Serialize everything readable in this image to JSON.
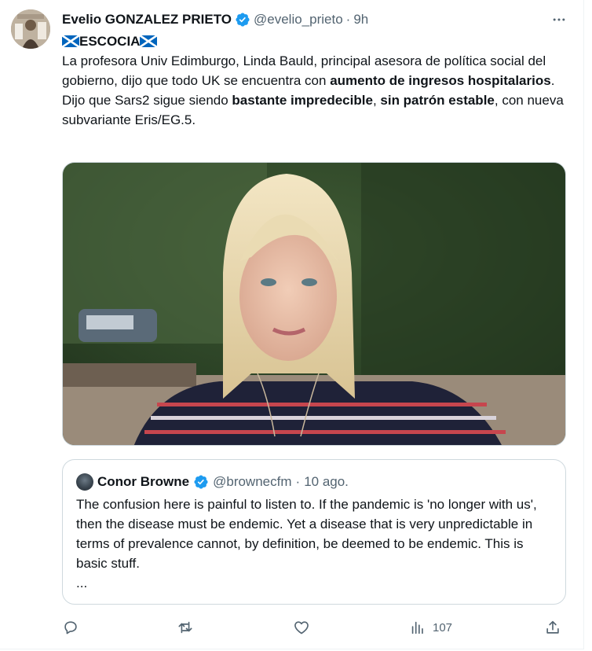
{
  "tweet": {
    "author_name": "Evelio GONZALEZ PRIETO",
    "author_handle": "@evelio_prieto",
    "separator": "·",
    "time": "9h",
    "title_text": "ESCOCIA",
    "line1_prefix": "La profesora Univ Edimburgo, Linda Bauld, principal asesora de política social del gobierno, dijo que todo UK se encuentra con ",
    "line1_bold": "aumento de ingresos hospitalarios",
    "line1_suffix": ".",
    "line2_prefix": "Dijo que Sars2 sigue siendo ",
    "line2_bold1": "bastante impredecible",
    "line2_mid": ", ",
    "line2_bold2": "sin patrón estable",
    "line2_suffix": ", con nueva subvariante Eris/EG.5."
  },
  "quoted_tweet": {
    "author_name": "Conor Browne",
    "author_handle": "@brownecfm",
    "separator": "·",
    "time": "10 ago.",
    "text": "The confusion here is painful to listen to. If the pandemic is 'no longer with us', then the disease must be endemic. Yet a disease that is very unpredictable in terms of prevalence cannot, by definition, be deemed to be endemic. This is basic stuff.",
    "ellipsis": "..."
  },
  "actions": {
    "views_count": "107"
  },
  "icons": {
    "more": "more-horizontal-icon",
    "verified": "verified-badge-icon",
    "flag": "scotland-flag-icon",
    "reply": "reply-icon",
    "retweet": "retweet-icon",
    "like": "heart-icon",
    "views": "views-icon",
    "share": "share-icon"
  },
  "colors": {
    "verified": "#1d9bf0",
    "secondary_text": "#536471",
    "primary_text": "#0f1419",
    "border": "#cfd9de",
    "flag_blue": "#0065bd"
  }
}
